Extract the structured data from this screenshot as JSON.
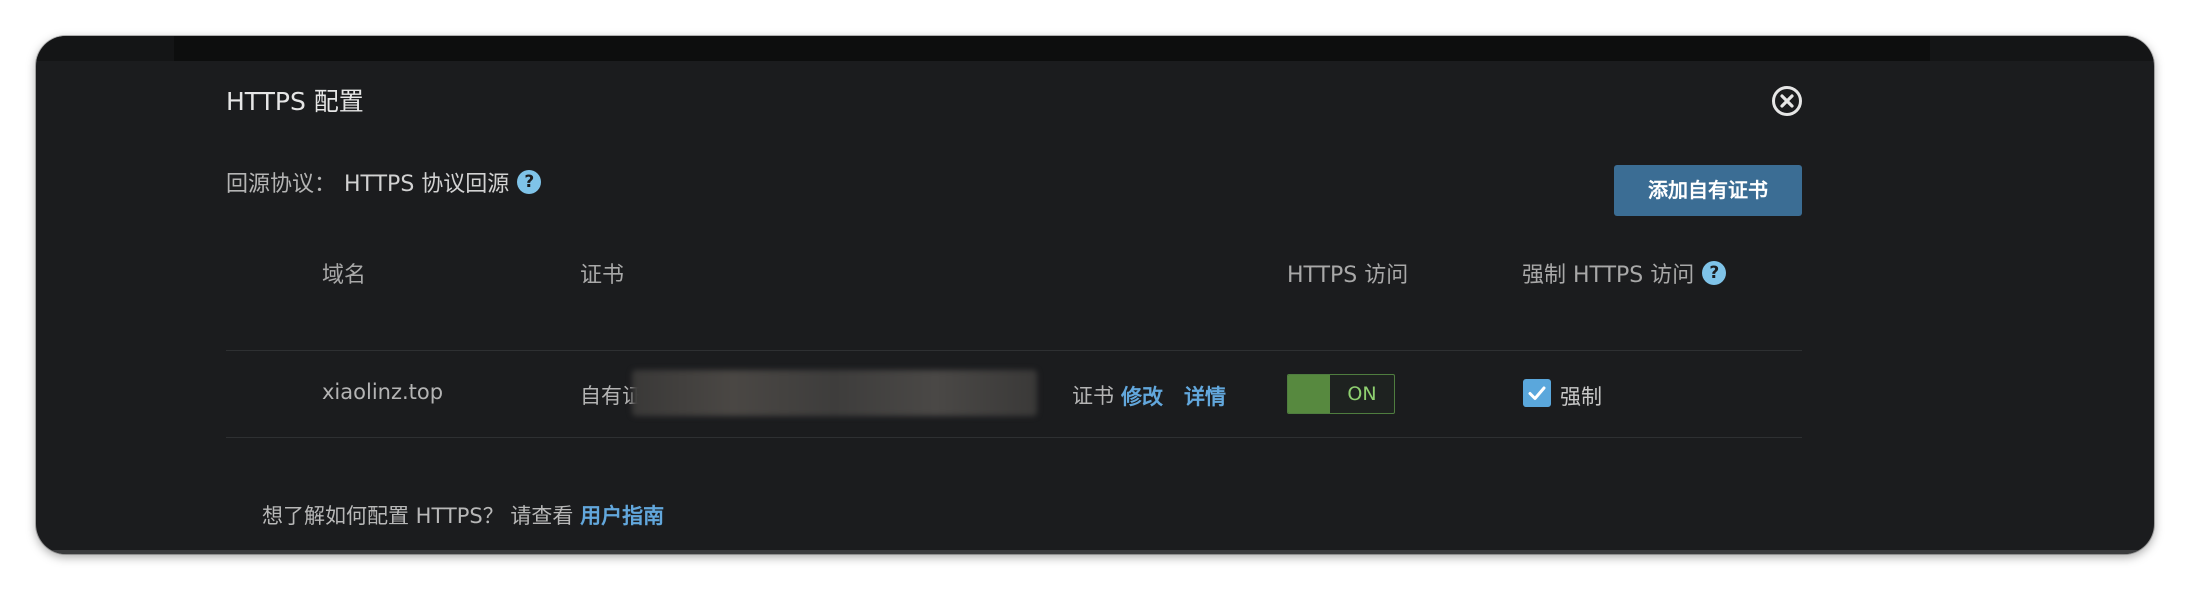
{
  "dialog": {
    "title": "HTTPS 配置"
  },
  "origin": {
    "label": "回源协议：",
    "value": "HTTPS 协议回源",
    "help_glyph": "?"
  },
  "add_cert_button": "添加自有证书",
  "table": {
    "headers": {
      "domain": "域名",
      "cert": "证书",
      "https_access": "HTTPS 访问",
      "force_https": "强制 HTTPS 访问",
      "help_glyph": "?"
    },
    "rows": [
      {
        "domain": "xiaolinz.top",
        "cert_prefix": "自有证书",
        "cert_suffix": "证书",
        "edit_link": "修改",
        "detail_link": "详情",
        "https_toggle": "ON",
        "force_checked": true,
        "force_label": "强制"
      }
    ]
  },
  "footer": {
    "text": "想了解如何配置 HTTPS？ 请查看",
    "link": "用户指南"
  },
  "colors": {
    "background": "#1b1c1e",
    "accent_button": "#3b6d94",
    "link": "#62a7dc",
    "toggle_on": "#57893f",
    "help_icon": "#7fc3e8"
  },
  "icons": {
    "close": "close-circle-icon",
    "help": "question-circle-icon",
    "check": "checkmark-icon"
  }
}
